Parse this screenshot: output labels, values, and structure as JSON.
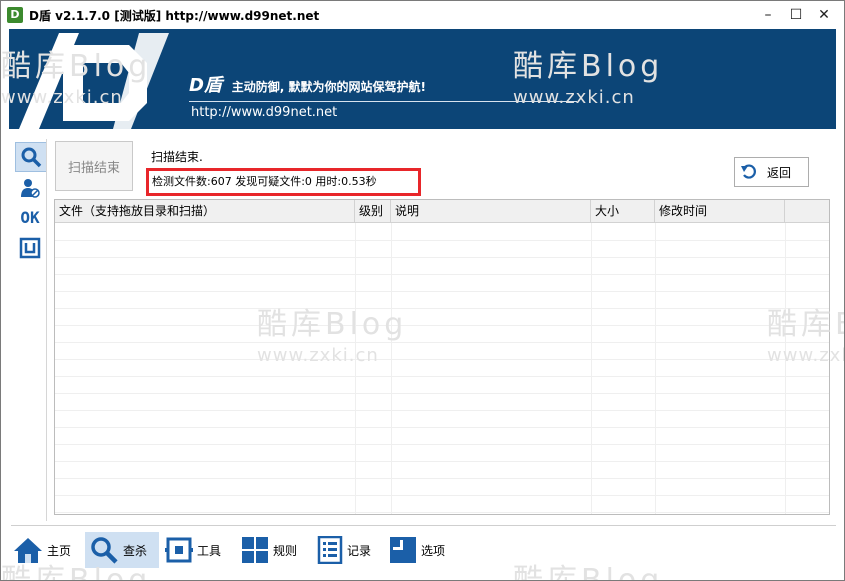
{
  "window": {
    "app_icon": "D",
    "title": "D盾 v2.1.7.0 [测试版] http://www.d99net.net",
    "minimize": "–",
    "maximize": "☐",
    "close": "✕"
  },
  "banner": {
    "brand": "D盾",
    "slogan": "主动防御, 默默为你的网站保驾护航!",
    "url": "http://www.d99net.net"
  },
  "sidebar": {
    "items": [
      {
        "icon": "magnifier-icon",
        "active": true
      },
      {
        "icon": "user-shield-icon",
        "active": false
      },
      {
        "icon": "ok-icon",
        "label": "OK",
        "active": false
      },
      {
        "icon": "bracket-box-icon",
        "active": false
      }
    ]
  },
  "scan": {
    "button_label": "扫描结束",
    "status": "扫描结束.",
    "summary": "检测文件数:607 发现可疑文件:0 用时:0.53秒",
    "back_label": "返回"
  },
  "table": {
    "columns": [
      "文件（支持拖放目录和扫描）",
      "级别",
      "说明",
      "大小",
      "修改时间"
    ],
    "rows": []
  },
  "watermark": {
    "title": "酷库Blog",
    "url": "www.zxki.cn"
  },
  "nav": {
    "items": [
      {
        "label": "主页",
        "icon": "home-icon"
      },
      {
        "label": "查杀",
        "icon": "search-icon",
        "active": true
      },
      {
        "label": "工具",
        "icon": "tools-icon"
      },
      {
        "label": "规则",
        "icon": "grid-icon"
      },
      {
        "label": "记录",
        "icon": "list-icon"
      },
      {
        "label": "选项",
        "icon": "options-icon"
      }
    ]
  },
  "colors": {
    "banner": "#0c4577",
    "accent": "#1b5fa8",
    "highlight_border": "#e8262a",
    "active_bg": "#cfe0f2"
  }
}
